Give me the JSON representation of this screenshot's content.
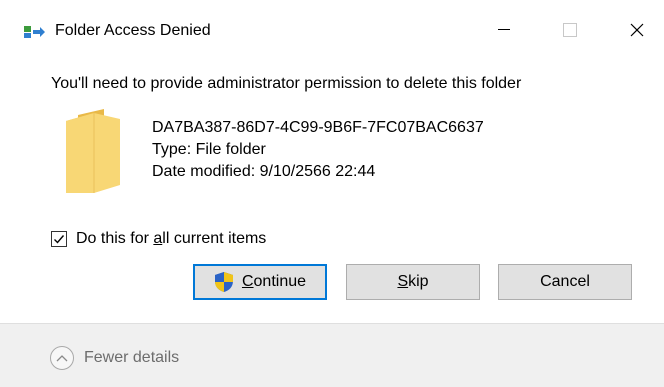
{
  "window": {
    "title": "Folder Access Denied",
    "controls": {
      "minimize": "minimize-icon",
      "maximize": "maximize-icon",
      "close": "close-icon"
    }
  },
  "message": {
    "heading": "You'll need to provide administrator permission to delete this folder"
  },
  "item": {
    "icon": "folder-icon",
    "name": "DA7BA387-86D7-4C99-9B6F-7FC07BAC6637",
    "type": "Type: File folder",
    "date_modified": "Date modified: 9/10/2566 22:44"
  },
  "apply_all": {
    "checked": true,
    "label_before": "Do this for ",
    "label_accel": "a",
    "label_after": "ll current items"
  },
  "buttons": {
    "continue_accel": "C",
    "continue_rest": "ontinue",
    "skip_accel": "S",
    "skip_rest": "kip",
    "cancel": "Cancel"
  },
  "footer": {
    "toggle_label": "Fewer details"
  },
  "colors": {
    "accent": "#0078d7",
    "folder": "#f8d775",
    "button_face": "#e1e1e1",
    "footer_bg": "#f0f0f0"
  }
}
